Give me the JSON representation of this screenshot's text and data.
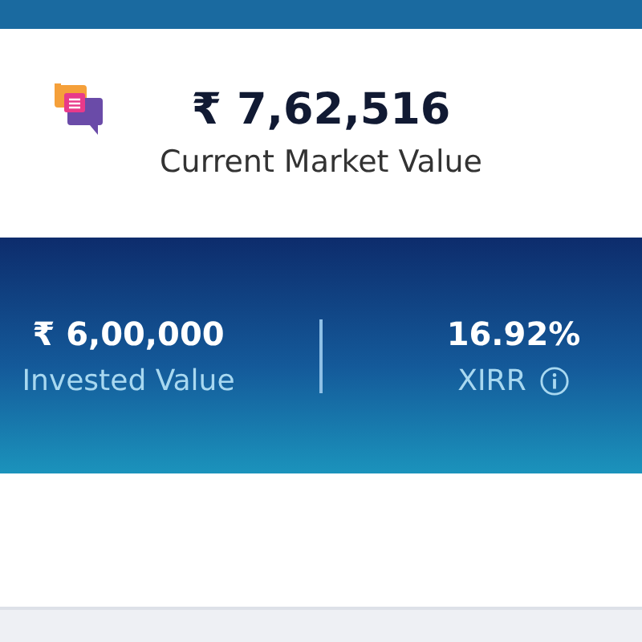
{
  "current": {
    "value": "₹ 7,62,516",
    "label": "Current Market Value"
  },
  "stats": [
    {
      "value": "₹ 6,00,000",
      "label": "Invested Value",
      "info": false
    },
    {
      "value": "16.92%",
      "label": "XIRR",
      "info": true
    }
  ]
}
